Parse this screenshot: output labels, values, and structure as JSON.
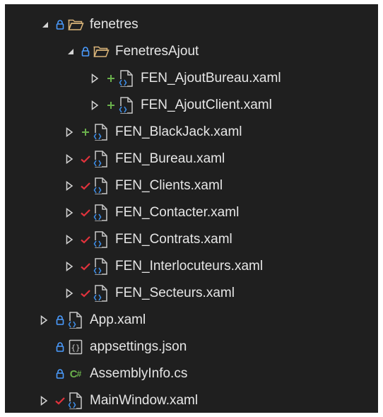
{
  "explorer": {
    "items": [
      {
        "label": "fenetres",
        "status": "lock",
        "icon": "folder-icon",
        "expand": "expanded"
      },
      {
        "label": "FenetresAjout",
        "status": "lock",
        "icon": "folder-icon",
        "expand": "expanded"
      },
      {
        "label": "FEN_AjoutBureau.xaml",
        "status": "added",
        "icon": "xaml-file-icon",
        "expand": "collapsed"
      },
      {
        "label": "FEN_AjoutClient.xaml",
        "status": "added",
        "icon": "xaml-file-icon",
        "expand": "collapsed"
      },
      {
        "label": "FEN_BlackJack.xaml",
        "status": "added",
        "icon": "xaml-file-icon",
        "expand": "collapsed"
      },
      {
        "label": "FEN_Bureau.xaml",
        "status": "checked-in",
        "icon": "xaml-file-icon",
        "expand": "collapsed"
      },
      {
        "label": "FEN_Clients.xaml",
        "status": "checked-in",
        "icon": "xaml-file-icon",
        "expand": "collapsed"
      },
      {
        "label": "FEN_Contacter.xaml",
        "status": "checked-in",
        "icon": "xaml-file-icon",
        "expand": "collapsed"
      },
      {
        "label": "FEN_Contrats.xaml",
        "status": "checked-in",
        "icon": "xaml-file-icon",
        "expand": "collapsed"
      },
      {
        "label": "FEN_Interlocuteurs.xaml",
        "status": "checked-in",
        "icon": "xaml-file-icon",
        "expand": "collapsed"
      },
      {
        "label": "FEN_Secteurs.xaml",
        "status": "checked-in",
        "icon": "xaml-file-icon",
        "expand": "collapsed"
      },
      {
        "label": "App.xaml",
        "status": "lock",
        "icon": "xaml-file-icon",
        "expand": "collapsed"
      },
      {
        "label": "appsettings.json",
        "status": "lock",
        "icon": "json-file-icon",
        "expand": "none"
      },
      {
        "label": "AssemblyInfo.cs",
        "status": "lock",
        "icon": "csharp-file-icon",
        "expand": "none"
      },
      {
        "label": "MainWindow.xaml",
        "status": "checked-in",
        "icon": "xaml-file-icon",
        "expand": "collapsed"
      }
    ]
  },
  "colors": {
    "background": "#1f1f1f",
    "text": "#e6e6e6",
    "lock": "#4a9cff",
    "added": "#6ab04c",
    "checked": "#e0323c",
    "folder": "#dcb67a",
    "file_outline": "#c8c8c8",
    "file_accent": "#3c8ce6"
  },
  "csharp_icon_text": {
    "c": "C",
    "hash": "#"
  },
  "json_icon_text": "{}"
}
